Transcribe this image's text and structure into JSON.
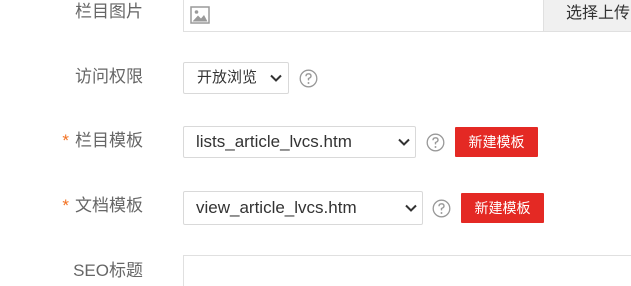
{
  "fields": {
    "column_image": {
      "label": "栏目图片",
      "upload_button": "选择上传"
    },
    "access": {
      "label": "访问权限",
      "value": "开放浏览"
    },
    "column_template": {
      "required_mark": "*",
      "label": "栏目模板",
      "value": "lists_article_lvcs.htm",
      "new_button": "新建模板"
    },
    "doc_template": {
      "required_mark": "*",
      "label": "文档模板",
      "value": "view_article_lvcs.htm",
      "new_button": "新建模板"
    },
    "seo_title": {
      "label": "SEO标题",
      "value": ""
    }
  },
  "colors": {
    "accent_red": "#e42924",
    "required_orange": "#f27020",
    "label_grey": "#666666"
  },
  "icons": [
    "image-icon",
    "chevron-down-icon",
    "help-icon"
  ]
}
